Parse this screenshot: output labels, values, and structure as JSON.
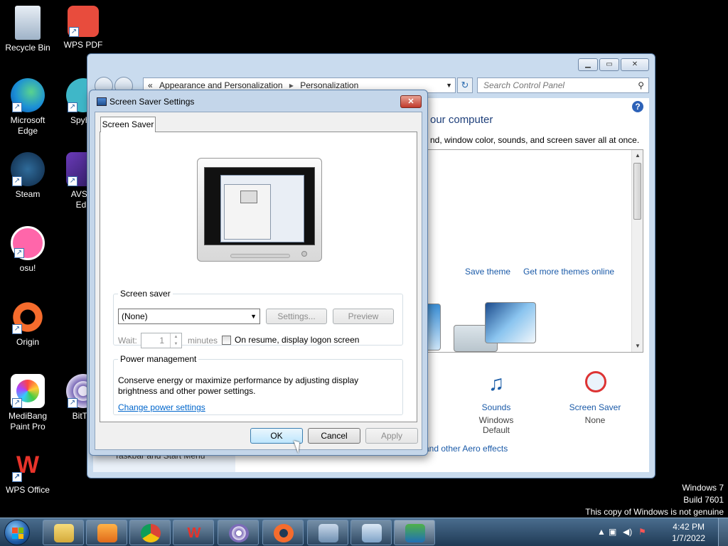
{
  "desktop": {
    "icons": [
      {
        "label": "Recycle Bin",
        "icon": "recycle-bin-icon"
      },
      {
        "label": "WPS PDF",
        "icon": "wps-pdf-icon"
      },
      {
        "label": "Microsoft Edge",
        "icon": "edge-icon"
      },
      {
        "label": "SpyHu",
        "icon": "spyhunter-icon"
      },
      {
        "label": "Steam",
        "icon": "steam-icon"
      },
      {
        "label": "AVS V\nEdit",
        "icon": "avs-video-editor-icon"
      },
      {
        "label": "osu!",
        "icon": "osu-icon"
      },
      {
        "label": "Origin",
        "icon": "origin-icon"
      },
      {
        "label": "MediBang Paint Pro",
        "icon": "medibang-icon"
      },
      {
        "label": "BitTor",
        "icon": "bittorrent-icon"
      },
      {
        "label": "WPS Office",
        "icon": "wps-office-icon"
      }
    ]
  },
  "control_panel": {
    "breadcrumb": {
      "prefix": "«",
      "part1": "Appearance and Personalization",
      "part2": "Personalization"
    },
    "search_placeholder": "Search Control Panel",
    "heading": "our computer",
    "subheading": "nd, window color, sounds, and screen saver all at once.",
    "links": {
      "save_theme": "Save theme",
      "get_more": "Get more themes online"
    },
    "tiles": {
      "sounds": {
        "label": "Sounds",
        "value": "Windows Default"
      },
      "screen_saver": {
        "label": "Screen Saver",
        "value": "None"
      }
    },
    "aero_link": "and other Aero effects",
    "sidebar_text": "Taskbar and Start Menu"
  },
  "dialog": {
    "title": "Screen Saver Settings",
    "close": "✕",
    "tab": "Screen Saver",
    "screen_saver_group": "Screen saver",
    "selected_saver": "(None)",
    "settings_button": "Settings...",
    "preview_button": "Preview",
    "wait_label": "Wait:",
    "wait_value": "1",
    "minutes_label": "minutes",
    "logon_checkbox": "On resume, display logon screen",
    "power_group": "Power management",
    "power_text": "Conserve energy or maximize performance by adjusting display brightness and other power settings.",
    "power_link": "Change power settings",
    "ok": "OK",
    "cancel": "Cancel",
    "apply": "Apply"
  },
  "watermark": {
    "line1": "Windows 7",
    "line2": "Build 7601",
    "line3": "This copy of Windows is not genuine"
  },
  "taskbar": {
    "apps": [
      "file-explorer-icon",
      "media-player-icon",
      "chrome-icon",
      "wps-office-icon",
      "bittorrent-icon",
      "origin-icon",
      "network-setup-icon",
      "control-panel-icon",
      "display-settings-icon"
    ],
    "time": "4:42 PM",
    "date": "1/7/2022"
  }
}
